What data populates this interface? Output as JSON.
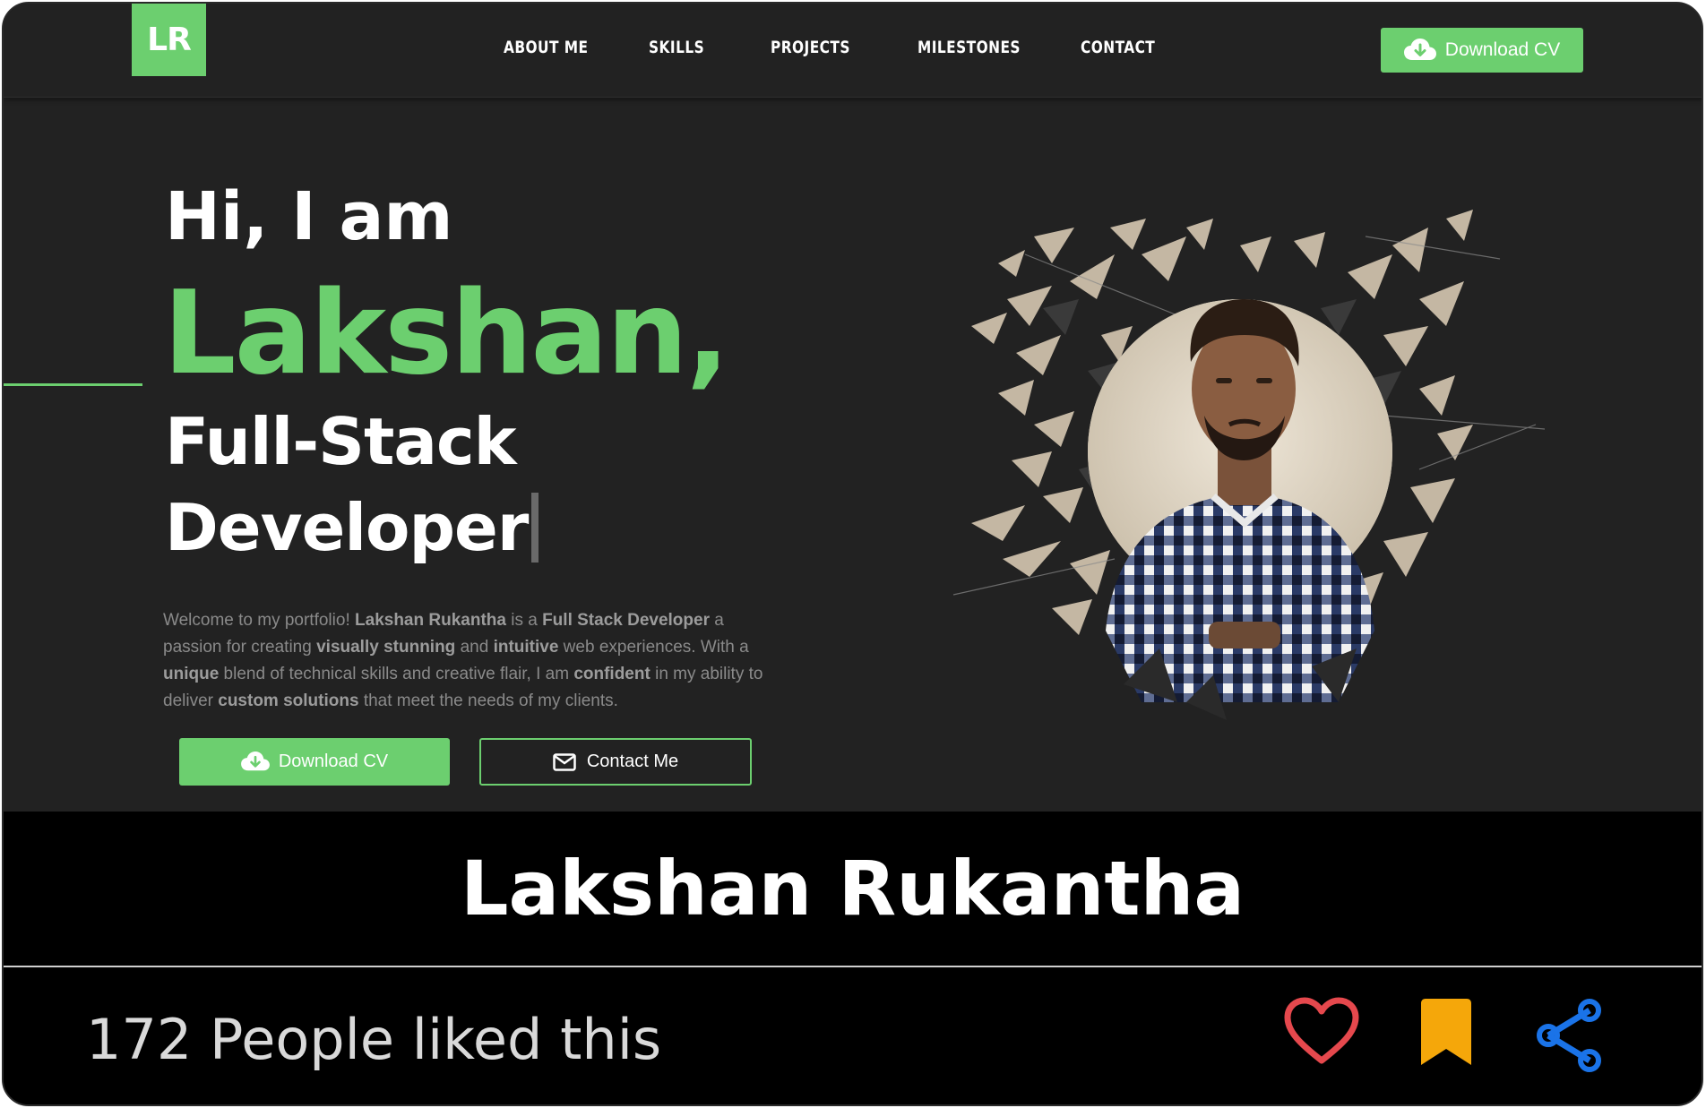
{
  "nav": {
    "logo": "LR",
    "links": [
      "ABOUT ME",
      "SKILLS",
      "PROJECTS",
      "MILESTONES",
      "CONTACT"
    ],
    "download_cv": "Download CV"
  },
  "hero": {
    "greeting": "Hi, I am",
    "name": "Lakshan,",
    "role_line1": "Full-Stack",
    "role_line2": "Developer",
    "intro": [
      {
        "t": "Welcome to my portfolio! ",
        "b": false
      },
      {
        "t": "Lakshan Rukantha",
        "b": true
      },
      {
        "t": " is a ",
        "b": false
      },
      {
        "t": "Full Stack Developer",
        "b": true
      },
      {
        "t": " a passion for creating ",
        "b": false
      },
      {
        "t": "visually stunning",
        "b": true
      },
      {
        "t": " and ",
        "b": false
      },
      {
        "t": "intuitive",
        "b": true
      },
      {
        "t": " web experiences. With a ",
        "b": false
      },
      {
        "t": "unique",
        "b": true
      },
      {
        "t": " blend of technical skills and creative flair, I am ",
        "b": false
      },
      {
        "t": "confident",
        "b": true
      },
      {
        "t": " in my ability to deliver ",
        "b": false
      },
      {
        "t": "custom solutions",
        "b": true
      },
      {
        "t": " that meet the needs of my clients.",
        "b": false
      }
    ],
    "download_cv": "Download CV",
    "contact_me": "Contact Me"
  },
  "caption": {
    "title": "Lakshan Rukantha"
  },
  "footer": {
    "likes_text": "172 People liked this"
  },
  "colors": {
    "accent": "#6ccf6f",
    "background": "#222222",
    "heart": "#e5484d",
    "bookmark": "#f5a70a",
    "share": "#1a73e8"
  },
  "icons": [
    "cloud-download-icon",
    "envelope-icon",
    "heart-icon",
    "bookmark-icon",
    "share-icon"
  ]
}
